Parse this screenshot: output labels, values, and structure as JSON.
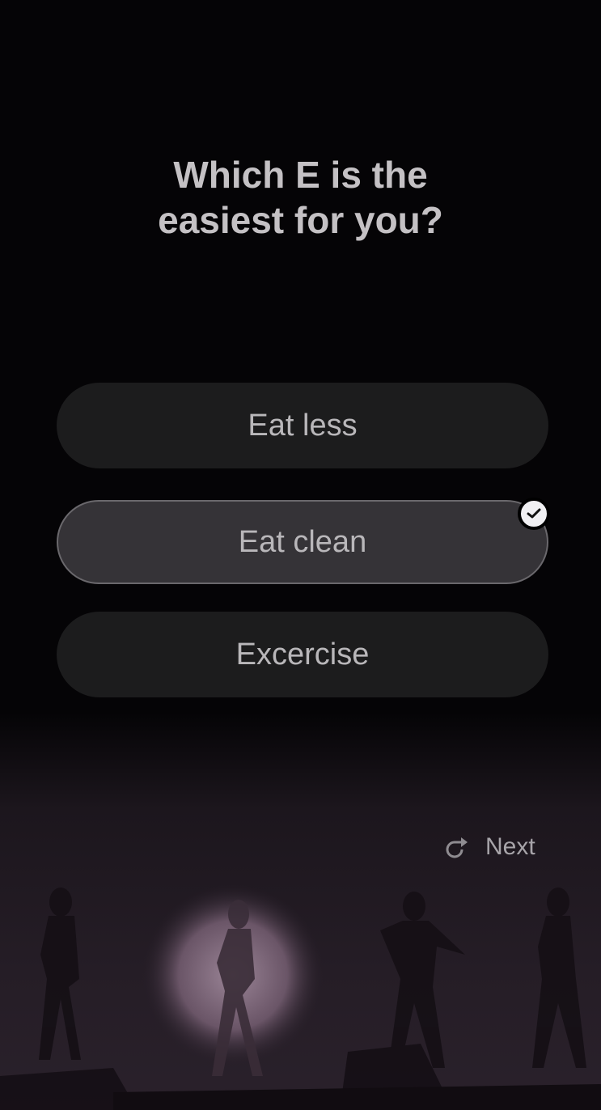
{
  "question": {
    "line1": "Which E is the",
    "line2": "easiest for you?"
  },
  "options": [
    {
      "label": "Eat less",
      "selected": false
    },
    {
      "label": "Eat clean",
      "selected": true
    },
    {
      "label": "Excercise",
      "selected": false
    }
  ],
  "next_label": "Next",
  "icons": {
    "selected": "checkmark-icon",
    "next": "redo-arrow-icon"
  }
}
